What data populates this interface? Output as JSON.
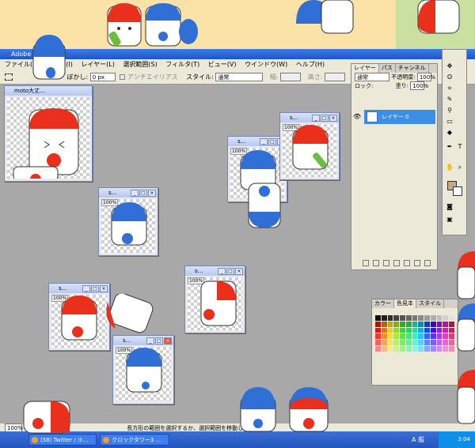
{
  "app": {
    "title": "Adobe",
    "menu": [
      "ファイル(F)",
      "メージ(I)",
      "レイヤー(L)",
      "選択範囲(S)",
      "フィルタ(T)",
      "ビュー(V)",
      "ウインドウ(W)",
      "ヘルプ(H)"
    ],
    "options": {
      "feather_label": "ぼかし:",
      "feather_value": "0 px",
      "antialias_label": "アンチエイリアス",
      "style_label": "スタイル:",
      "style_value": "通常",
      "width_label": "幅:",
      "height_label": "高さ:"
    }
  },
  "documents": [
    {
      "title": "moto大丈...",
      "zoom": ""
    },
    {
      "title": "s...",
      "zoom": "100%"
    },
    {
      "title": "s...",
      "zoom": "100%"
    },
    {
      "title": "s...",
      "zoom": "100%"
    },
    {
      "title": "s...",
      "zoom": "100%"
    },
    {
      "title": "s...",
      "zoom": "100%"
    },
    {
      "title": "s...",
      "zoom": "100%"
    }
  ],
  "layers_panel": {
    "tabs": [
      "レイヤー",
      "パス",
      "チャンネル"
    ],
    "blend_mode": "通常",
    "opacity_label": "不透明度:",
    "opacity_value": "100%",
    "lock_label": "ロック:",
    "fill_label": "塗り:",
    "fill_value": "100%",
    "layer_name": "レイヤー 0"
  },
  "swatches_panel": {
    "tabs": [
      "カラー",
      "色見本",
      "スタイル"
    ]
  },
  "status": {
    "zoom": "100%",
    "hint": "長方形の範囲を選択するか、選択範囲を移動します..."
  },
  "taskbar": {
    "items": [
      "(58) Twitter / ホ...",
      "クロックタワー3 ..."
    ],
    "ime": "A 般",
    "clock": "3:04"
  },
  "colors": {
    "red": "#e8301c",
    "blue": "#2f6fd6",
    "layer_highlight": "#3d8fe6"
  }
}
